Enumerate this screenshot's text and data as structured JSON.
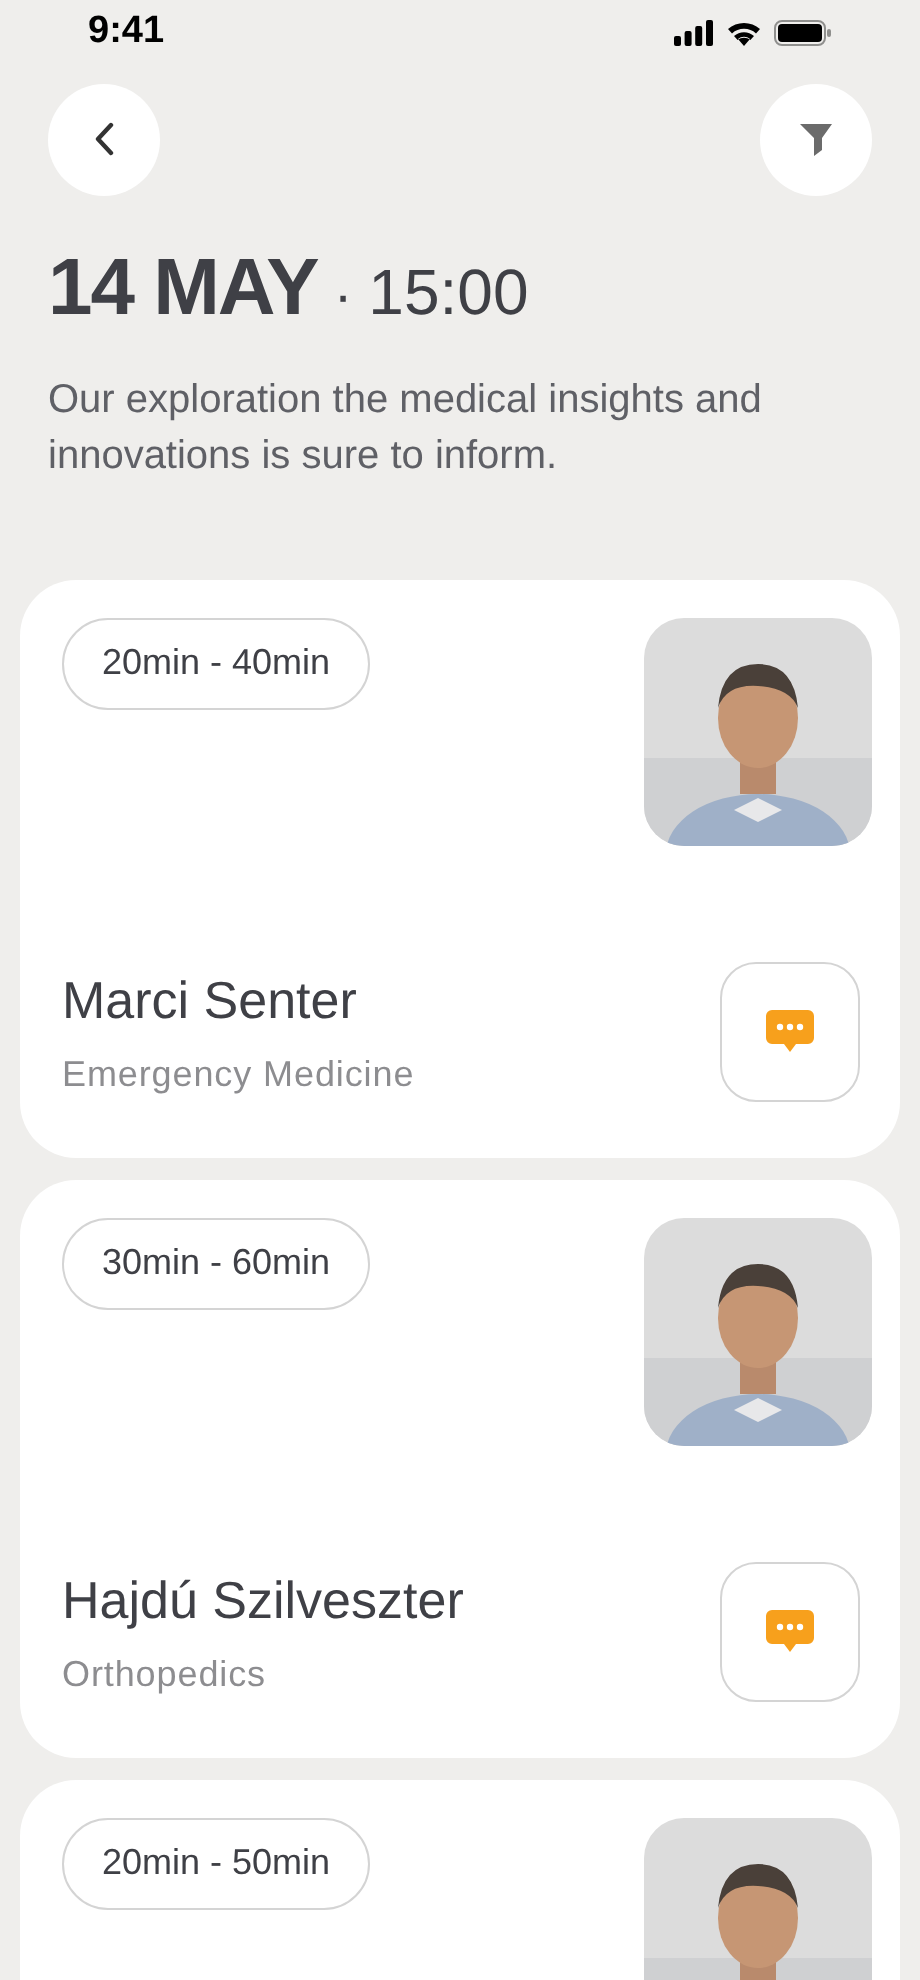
{
  "status_bar": {
    "time": "9:41"
  },
  "header": {
    "date": "14 MAY",
    "separator": "·",
    "time": "15:00",
    "description": "Our exploration the medical insights and innovations is sure to inform."
  },
  "doctors": [
    {
      "duration": "20min - 40min",
      "name": "Marci Senter",
      "specialty": "Emergency Medicine"
    },
    {
      "duration": "30min - 60min",
      "name": "Hajdú Szilveszter",
      "specialty": "Orthopedics"
    },
    {
      "duration": "20min - 50min"
    }
  ]
}
